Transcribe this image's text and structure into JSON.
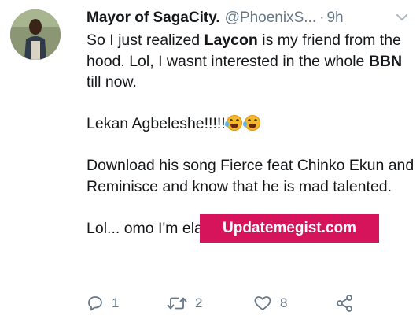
{
  "tweet": {
    "display_name": "Mayor of SagaCity.",
    "handle": "@PhoenixS...",
    "separator": "·",
    "time": "9h",
    "paragraphs": {
      "p1_start": "So I just realized ",
      "p1_bold1": "Laycon",
      "p1_mid": " is my friend from the hood. Lol, I wasnt interested in the whole ",
      "p1_bold2": "BBN",
      "p1_end": " till now.",
      "p2": "Lekan Agbeleshe!!!!!",
      "p3": "Download his song Fierce feat Chinko Ekun and Reminisce and know that he is mad talented.",
      "p4": "Lol... omo I'm elated for my guy!!!!"
    },
    "emojis": [
      "rolling-on-floor-laughing",
      "rolling-on-floor-laughing"
    ]
  },
  "watermark": {
    "text": "Updatemegist.com",
    "color": "#d6145c"
  },
  "actions": {
    "reply_count": "1",
    "retweet_count": "2",
    "like_count": "8"
  },
  "colors": {
    "text": "#14171a",
    "secondary": "#657786"
  }
}
